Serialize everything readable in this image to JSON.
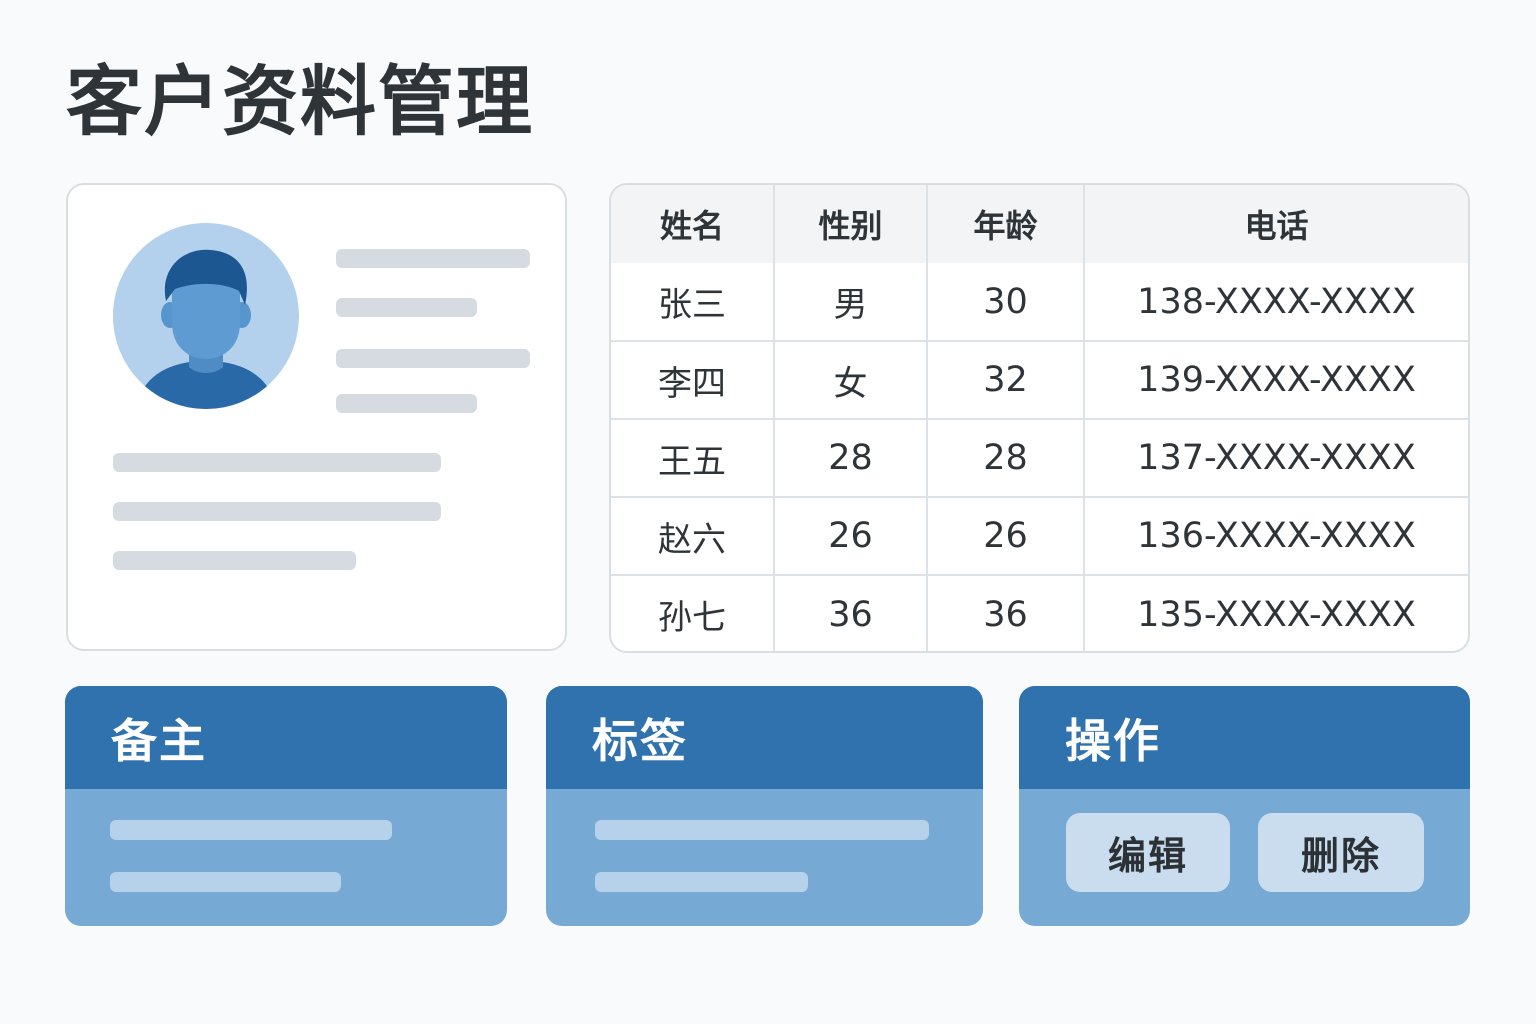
{
  "page": {
    "title": "客户资料管理"
  },
  "profile": {
    "avatar_icon": "user-avatar-icon"
  },
  "table": {
    "columns": [
      "姓名",
      "性别",
      "年龄",
      "电话"
    ],
    "rows": [
      [
        "张三",
        "男",
        "30",
        "138-XXXX-XXXX"
      ],
      [
        "李四",
        "女",
        "32",
        "139-XXXX-XXXX"
      ],
      [
        "王五",
        "28",
        "28",
        "137-XXXX-XXXX"
      ],
      [
        "赵六",
        "26",
        "26",
        "136-XXXX-XXXX"
      ],
      [
        "孙七",
        "36",
        "36",
        "135-XXXX-XXXX"
      ]
    ]
  },
  "panels": {
    "notes": {
      "title": "备主"
    },
    "tags": {
      "title": "标签"
    },
    "actions": {
      "title": "操作",
      "edit_label": "编辑",
      "delete_label": "删除"
    }
  },
  "colors": {
    "accent": "#2f72ae",
    "panel_body": "#76a9d3",
    "button_bg": "#c9ddef"
  }
}
